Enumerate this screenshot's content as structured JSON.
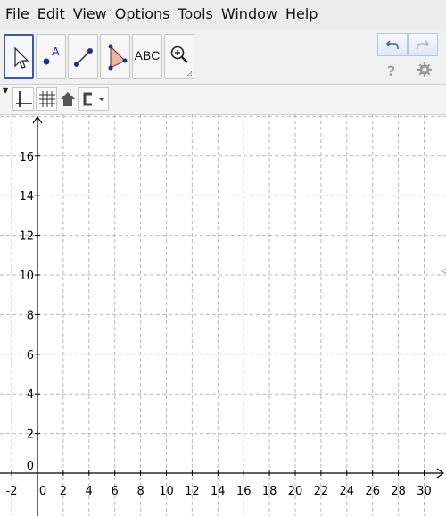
{
  "menu": [
    "File",
    "Edit",
    "View",
    "Options",
    "Tools",
    "Window",
    "Help"
  ],
  "toolbar": {
    "tools": [
      {
        "name": "move-tool-button",
        "icon": "arrow-cursor-icon"
      },
      {
        "name": "point-tool-button",
        "icon": "point-a-icon",
        "label": "A"
      },
      {
        "name": "segment-tool-button",
        "icon": "segment-icon"
      },
      {
        "name": "polygon-tool-button",
        "icon": "triangle-icon"
      },
      {
        "name": "text-tool-button",
        "icon": "text-abc-icon",
        "label": "ABC"
      },
      {
        "name": "zoom-tool-button",
        "icon": "zoom-in-icon"
      }
    ],
    "help_label": "?",
    "undo_icon": "undo-icon",
    "redo_icon": "redo-icon",
    "settings_icon": "gear-icon"
  },
  "stylebar": {
    "buttons": [
      "axes-toggle-icon",
      "grid-toggle-icon",
      "home-icon",
      "point-capture-icon"
    ]
  },
  "graph": {
    "x_tick_labels": [
      "-2",
      "0",
      "2",
      "4",
      "6",
      "8",
      "10",
      "12",
      "14",
      "16",
      "18",
      "20",
      "22",
      "24",
      "26",
      "28",
      "30"
    ],
    "y_tick_labels": [
      "0",
      "2",
      "4",
      "6",
      "8",
      "10",
      "12",
      "14",
      "16"
    ],
    "x_range": [
      -3,
      31
    ],
    "y_range": [
      -0.6,
      17.5
    ],
    "grid": true,
    "colors": {
      "grid": "#b9b9b9",
      "axis": "#000000",
      "accent": "#3a5aa8"
    }
  }
}
